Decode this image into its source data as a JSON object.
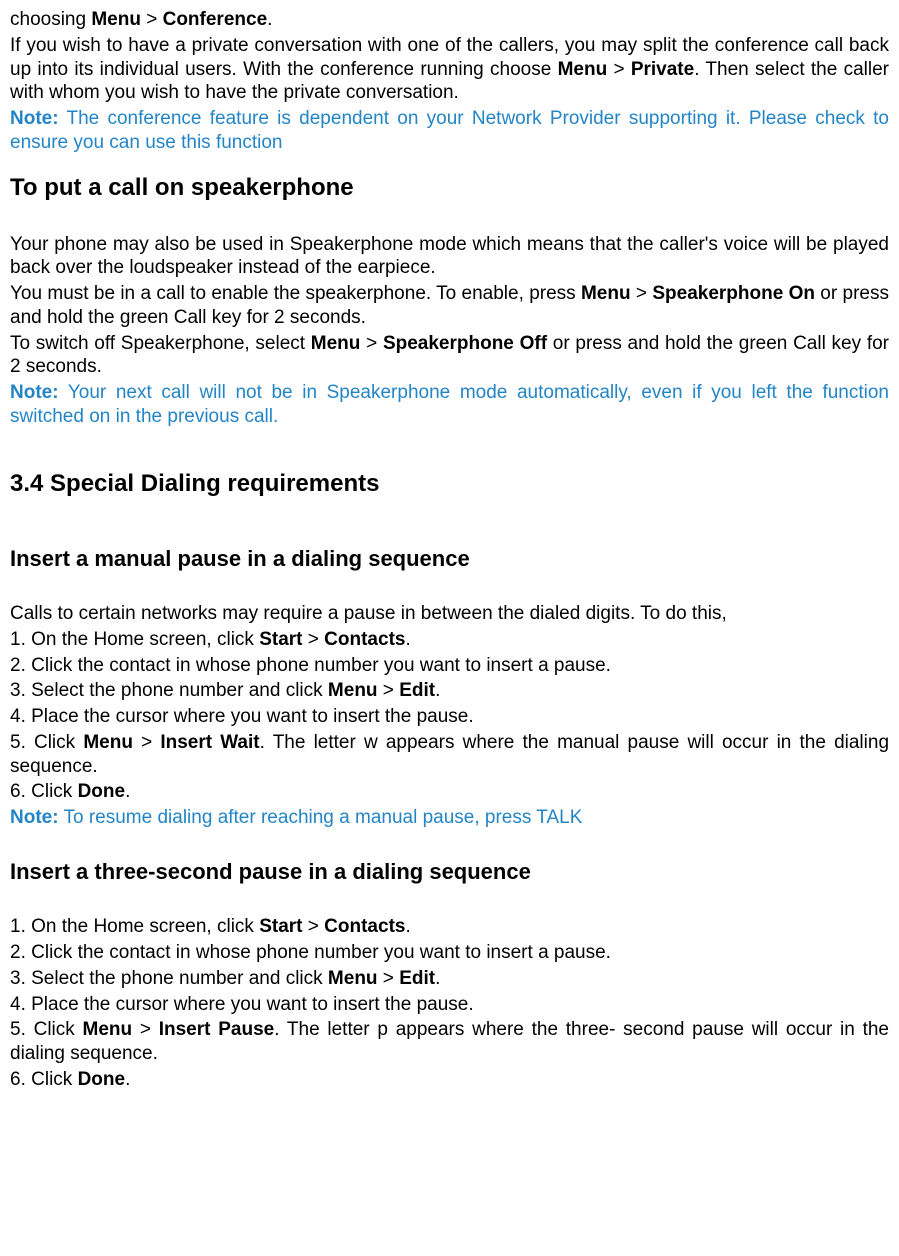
{
  "intro": {
    "line1_a": "choosing ",
    "line1_b": "Menu",
    "line1_c": " > ",
    "line1_d": "Conference",
    "line1_e": ".",
    "para2_a": "If you wish to have a private conversation with one of the callers, you may split the conference call back up into its individual users. With the conference running choose ",
    "para2_b": "Menu",
    "para2_c": " > ",
    "para2_d": "Private",
    "para2_e": ". Then select the caller with whom you wish to have the private conversation.",
    "note_label": "Note:",
    "note_text": " The conference feature is dependent on your Network Provider supporting it. Please check to ensure you can use this function"
  },
  "speaker": {
    "heading": "To put a call on speakerphone",
    "p1": "Your phone may also be used in Speakerphone mode which means that the caller's voice will be played back over the loudspeaker instead of the earpiece.",
    "p2_a": "You must be in a call to enable the speakerphone. To enable, press ",
    "p2_b": "Menu",
    "p2_c": " > ",
    "p2_d": "Speakerphone On",
    "p2_e": " or press and hold the green Call key for 2 seconds.",
    "p3_a": "To switch off Speakerphone, select ",
    "p3_b": "Menu",
    "p3_c": " > ",
    "p3_d": "Speakerphone Off",
    "p3_e": " or press and hold the green Call key for 2 seconds.",
    "note_label": "Note:",
    "note_text": " Your next call will not be in Speakerphone mode automatically, even if you left the function switched on in the previous call."
  },
  "section34": {
    "heading": "3.4 Special Dialing requirements"
  },
  "manual": {
    "heading": "Insert a manual pause in a dialing sequence",
    "intro": "Calls to certain networks may require a pause in between the dialed digits. To do this,",
    "s1_a": "1. On the Home screen, click ",
    "s1_b": "Start",
    "s1_c": " > ",
    "s1_d": "Contacts",
    "s1_e": ".",
    "s2": "2. Click the contact in whose phone number you want to insert a pause.",
    "s3_a": "3. Select the phone number and click ",
    "s3_b": "Menu",
    "s3_c": " > ",
    "s3_d": "Edit",
    "s3_e": ".",
    "s4": "4. Place the cursor where you want to insert the pause.",
    "s5_a": "5. Click ",
    "s5_b": "Menu",
    "s5_c": " > ",
    "s5_d": "Insert Wait",
    "s5_e": ". The letter w appears where the manual pause will occur in the dialing sequence.",
    "s6_a": "6. Click ",
    "s6_b": "Done",
    "s6_e": ".",
    "note_label": "Note:",
    "note_text": " To resume dialing after reaching a manual pause, press TALK"
  },
  "threesec": {
    "heading": "Insert a three-second pause in a dialing sequence",
    "s1_a": "1. On the Home screen, click ",
    "s1_b": "Start",
    "s1_c": " > ",
    "s1_d": "Contacts",
    "s1_e": ".",
    "s2": "2. Click the contact in whose phone number you want to insert a pause.",
    "s3_a": "3. Select the phone number and click ",
    "s3_b": "Menu",
    "s3_c": " > ",
    "s3_d": "Edit",
    "s3_e": ".",
    "s4": "4. Place the cursor where you want to insert the pause.",
    "s5_a": "5. Click ",
    "s5_b": "Menu",
    "s5_c": " > ",
    "s5_d": "Insert Pause",
    "s5_e": ". The letter p appears where the three- second pause will occur in the dialing sequence.",
    "s6_a": "6. Click ",
    "s6_b": "Done",
    "s6_e": "."
  }
}
